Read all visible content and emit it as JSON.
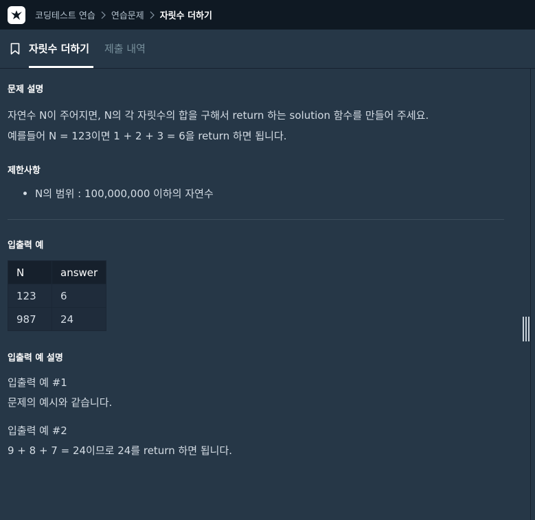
{
  "breadcrumb": {
    "items": [
      "코딩테스트 연습",
      "연습문제"
    ],
    "current": "자릿수 더하기"
  },
  "tabs": {
    "active": "자릿수 더하기",
    "inactive": "제출 내역"
  },
  "problem": {
    "description_heading": "문제 설명",
    "description_line1": "자연수 N이 주어지면, N의 각 자릿수의 합을 구해서 return 하는 solution 함수를 만들어 주세요.",
    "description_line2": "예를들어 N = 123이면 1 + 2 + 3 = 6을 return 하면 됩니다.",
    "constraints_heading": "제한사항",
    "constraints": [
      "N의 범위 : 100,000,000 이하의 자연수"
    ],
    "examples_heading": "입출력 예",
    "table": {
      "headers": [
        "N",
        "answer"
      ],
      "rows": [
        [
          "123",
          "6"
        ],
        [
          "987",
          "24"
        ]
      ]
    },
    "explanation_heading": "입출력 예 설명",
    "example1_title": "입출력 예 #1",
    "example1_text": "문제의 예시와 같습니다.",
    "example2_title": "입출력 예 #2",
    "example2_text": "9 + 8 + 7 = 24이므로 24를 return 하면 됩니다."
  },
  "icons": {
    "logo": "programmers-logo-icon",
    "separator": "chevron-right-icon",
    "bookmark": "bookmark-icon"
  }
}
